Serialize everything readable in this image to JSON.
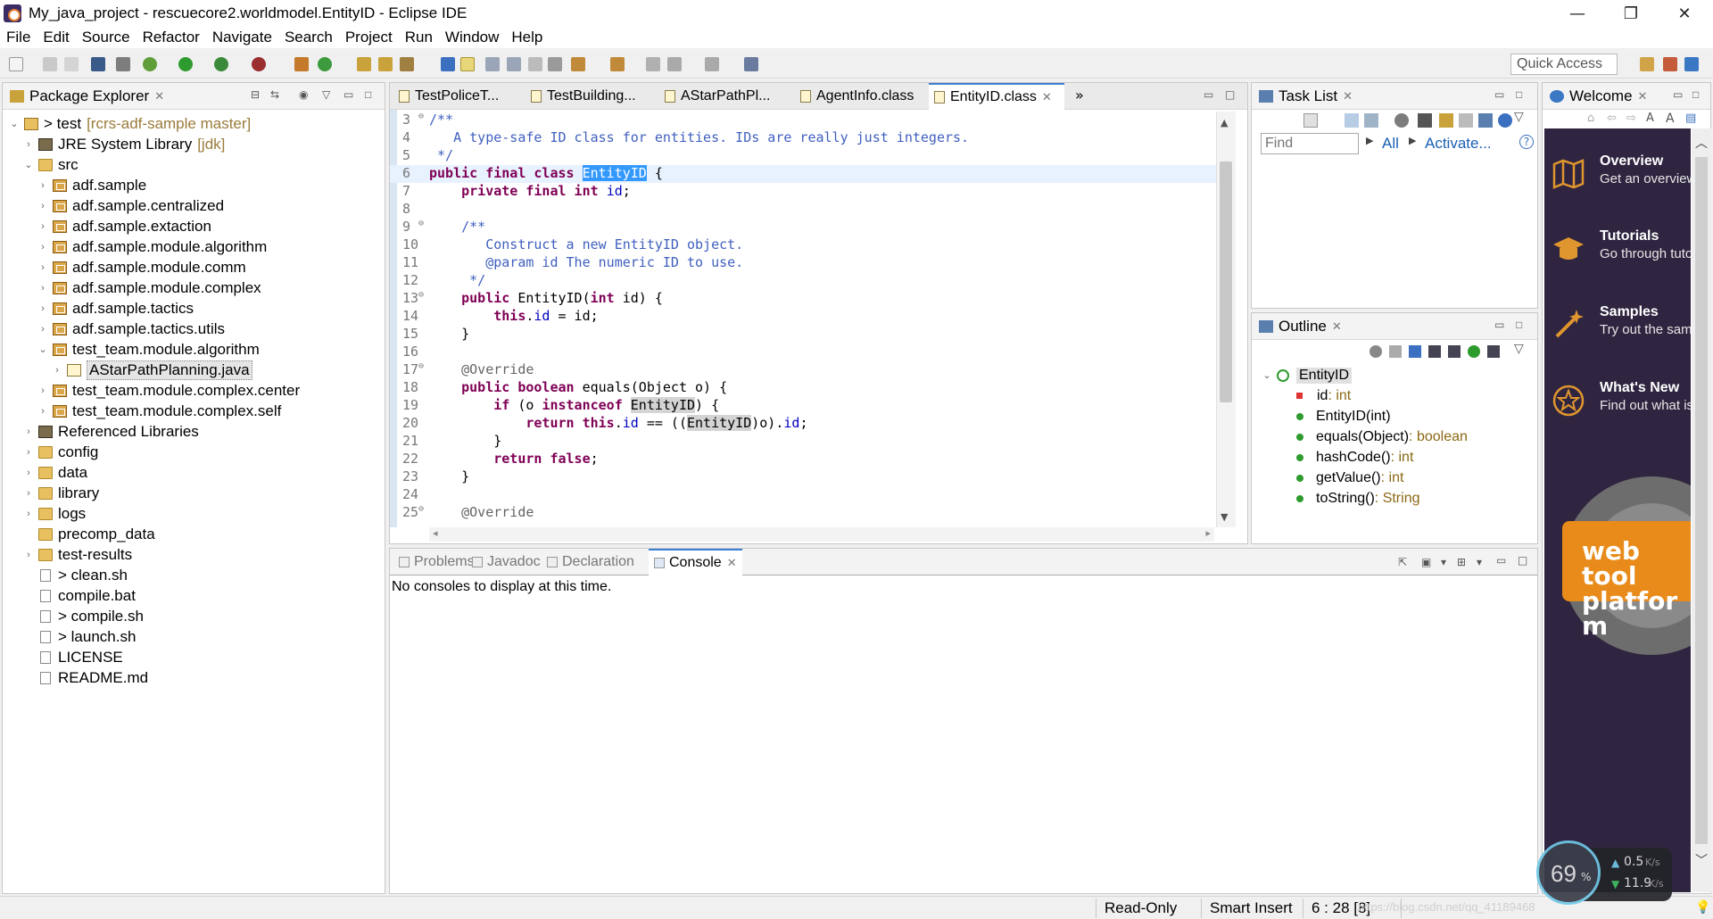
{
  "window": {
    "title": "My_java_project - rescuecore2.worldmodel.EntityID - Eclipse IDE",
    "minimize": "—",
    "maximize": "❐",
    "close": "✕"
  },
  "menu": [
    "File",
    "Edit",
    "Source",
    "Refactor",
    "Navigate",
    "Search",
    "Project",
    "Run",
    "Window",
    "Help"
  ],
  "quick_access": "Quick Access",
  "package_explorer": {
    "title": "Package Explorer",
    "items": [
      {
        "label": "> test",
        "extra": "[rcrs-adf-sample master]",
        "indent": 0,
        "tw": "⌄",
        "icon": "project"
      },
      {
        "label": "JRE System Library",
        "extra": "[jdk]",
        "indent": 1,
        "tw": "›",
        "icon": "lib"
      },
      {
        "label": "src",
        "extra": "",
        "indent": 1,
        "tw": "⌄",
        "icon": "folder"
      },
      {
        "label": "adf.sample",
        "extra": "",
        "indent": 2,
        "tw": "›",
        "icon": "pkg"
      },
      {
        "label": "adf.sample.centralized",
        "extra": "",
        "indent": 2,
        "tw": "›",
        "icon": "pkg"
      },
      {
        "label": "adf.sample.extaction",
        "extra": "",
        "indent": 2,
        "tw": "›",
        "icon": "pkg"
      },
      {
        "label": "adf.sample.module.algorithm",
        "extra": "",
        "indent": 2,
        "tw": "›",
        "icon": "pkg"
      },
      {
        "label": "adf.sample.module.comm",
        "extra": "",
        "indent": 2,
        "tw": "›",
        "icon": "pkg"
      },
      {
        "label": "adf.sample.module.complex",
        "extra": "",
        "indent": 2,
        "tw": "›",
        "icon": "pkg"
      },
      {
        "label": "adf.sample.tactics",
        "extra": "",
        "indent": 2,
        "tw": "›",
        "icon": "pkg"
      },
      {
        "label": "adf.sample.tactics.utils",
        "extra": "",
        "indent": 2,
        "tw": "›",
        "icon": "pkg"
      },
      {
        "label": "test_team.module.algorithm",
        "extra": "",
        "indent": 2,
        "tw": "⌄",
        "icon": "pkg"
      },
      {
        "label": "AStarPathPlanning.java",
        "extra": "",
        "indent": 3,
        "tw": "›",
        "icon": "java",
        "selected": true
      },
      {
        "label": "test_team.module.complex.center",
        "extra": "",
        "indent": 2,
        "tw": "›",
        "icon": "pkg"
      },
      {
        "label": "test_team.module.complex.self",
        "extra": "",
        "indent": 2,
        "tw": "›",
        "icon": "pkg"
      },
      {
        "label": "Referenced Libraries",
        "extra": "",
        "indent": 1,
        "tw": "›",
        "icon": "lib"
      },
      {
        "label": "config",
        "extra": "",
        "indent": 1,
        "tw": "›",
        "icon": "folder"
      },
      {
        "label": "data",
        "extra": "",
        "indent": 1,
        "tw": "›",
        "icon": "folder"
      },
      {
        "label": "library",
        "extra": "",
        "indent": 1,
        "tw": "›",
        "icon": "folder"
      },
      {
        "label": "logs",
        "extra": "",
        "indent": 1,
        "tw": "›",
        "icon": "folder"
      },
      {
        "label": "precomp_data",
        "extra": "",
        "indent": 1,
        "tw": "",
        "icon": "folder"
      },
      {
        "label": "test-results",
        "extra": "",
        "indent": 1,
        "tw": "›",
        "icon": "folder"
      },
      {
        "label": "> clean.sh",
        "extra": "",
        "indent": 1,
        "tw": "",
        "icon": "file"
      },
      {
        "label": "compile.bat",
        "extra": "",
        "indent": 1,
        "tw": "",
        "icon": "file"
      },
      {
        "label": "> compile.sh",
        "extra": "",
        "indent": 1,
        "tw": "",
        "icon": "file"
      },
      {
        "label": "> launch.sh",
        "extra": "",
        "indent": 1,
        "tw": "",
        "icon": "file"
      },
      {
        "label": "LICENSE",
        "extra": "",
        "indent": 1,
        "tw": "",
        "icon": "file"
      },
      {
        "label": "README.md",
        "extra": "",
        "indent": 1,
        "tw": "",
        "icon": "file"
      }
    ]
  },
  "editor": {
    "tabs": [
      {
        "label": "TestPoliceT...",
        "active": false
      },
      {
        "label": "TestBuilding...",
        "active": false
      },
      {
        "label": "AStarPathPl...",
        "active": false
      },
      {
        "label": "AgentInfo.class",
        "active": false
      },
      {
        "label": "EntityID.class",
        "active": true
      }
    ],
    "overflow": "»",
    "lines": [
      {
        "n": "3",
        "fold": "⊖",
        "html": "<span class='cm'>/**</span>"
      },
      {
        "n": "4",
        "fold": "",
        "html": "<span class='cm'>   A type-safe ID class for entities. IDs are really just integers.</span>"
      },
      {
        "n": "5",
        "fold": "",
        "html": "<span class='cm'> */</span>"
      },
      {
        "n": "6",
        "fold": "",
        "html": "<span class='kw'>public final class</span> <span class='sel'>EntityID</span> {",
        "current": true
      },
      {
        "n": "7",
        "fold": "",
        "html": "    <span class='kw'>private final int</span> <span class='fld'>id</span>;"
      },
      {
        "n": "8",
        "fold": "",
        "html": ""
      },
      {
        "n": "9",
        "fold": "⊖",
        "html": "    <span class='cm'>/**</span>"
      },
      {
        "n": "10",
        "fold": "",
        "html": "<span class='cm'>       Construct a new EntityID object.</span>"
      },
      {
        "n": "11",
        "fold": "",
        "html": "<span class='cm'>       @param id The numeric ID to use.</span>"
      },
      {
        "n": "12",
        "fold": "",
        "html": "<span class='cm'>     */</span>"
      },
      {
        "n": "13",
        "fold": "⊖",
        "html": "    <span class='kw'>public</span> EntityID(<span class='kw'>int</span> id) {"
      },
      {
        "n": "14",
        "fold": "",
        "html": "        <span class='kw'>this</span>.<span class='fld'>id</span> = id;"
      },
      {
        "n": "15",
        "fold": "",
        "html": "    }"
      },
      {
        "n": "16",
        "fold": "",
        "html": ""
      },
      {
        "n": "17",
        "fold": "⊖",
        "html": "    <span class='ann'>@Override</span>"
      },
      {
        "n": "18",
        "fold": "",
        "html": "    <span class='kw'>public boolean</span> equals(Object o) {"
      },
      {
        "n": "19",
        "fold": "",
        "html": "        <span class='kw'>if</span> (o <span class='kw'>instanceof</span> <span class='hl'>EntityID</span>) {"
      },
      {
        "n": "20",
        "fold": "",
        "html": "            <span class='kw'>return this</span>.<span class='fld'>id</span> == ((<span class='hl'>EntityID</span>)o).<span class='fld'>id</span>;"
      },
      {
        "n": "21",
        "fold": "",
        "html": "        }"
      },
      {
        "n": "22",
        "fold": "",
        "html": "        <span class='kw'>return false</span>;"
      },
      {
        "n": "23",
        "fold": "",
        "html": "    }"
      },
      {
        "n": "24",
        "fold": "",
        "html": ""
      },
      {
        "n": "25",
        "fold": "⊖",
        "html": "    <span class='ann'>@Override</span>"
      }
    ]
  },
  "task_list": {
    "title": "Task List",
    "find_placeholder": "Find",
    "all": "All",
    "activate": "Activate..."
  },
  "outline": {
    "title": "Outline",
    "items": [
      {
        "label": "EntityID",
        "type": "",
        "indent": 0,
        "kind": "class"
      },
      {
        "label": "id",
        "type": " : int",
        "indent": 1,
        "kind": "field"
      },
      {
        "label": "EntityID(int)",
        "type": "",
        "indent": 1,
        "kind": "ctor"
      },
      {
        "label": "equals(Object)",
        "type": " : boolean",
        "indent": 1,
        "kind": "method"
      },
      {
        "label": "hashCode()",
        "type": " : int",
        "indent": 1,
        "kind": "method"
      },
      {
        "label": "getValue()",
        "type": " : int",
        "indent": 1,
        "kind": "method"
      },
      {
        "label": "toString()",
        "type": " : String",
        "indent": 1,
        "kind": "method"
      }
    ]
  },
  "welcome": {
    "title": "Welcome",
    "items": [
      {
        "title": "Overview",
        "desc": "Get an overview"
      },
      {
        "title": "Tutorials",
        "desc": "Go through tuto"
      },
      {
        "title": "Samples",
        "desc": "Try out the sam"
      },
      {
        "title": "What's New",
        "desc": "Find out what is"
      }
    ],
    "badge": "web tool platform"
  },
  "bottom_tabs": [
    {
      "label": "Problems",
      "active": false
    },
    {
      "label": "Javadoc",
      "active": false
    },
    {
      "label": "Declaration",
      "active": false
    },
    {
      "label": "Console",
      "active": true
    }
  ],
  "console_message": "No consoles to display at this time.",
  "status": {
    "mode": "Read-Only",
    "insert": "Smart Insert",
    "position": "6 : 28 [8]"
  },
  "net_monitor": {
    "percent": "69",
    "percent_unit": "%",
    "up": "0.5",
    "down": "11.9",
    "unit": "K/s"
  },
  "watermark": "https://blog.csdn.net/qq_41189468"
}
